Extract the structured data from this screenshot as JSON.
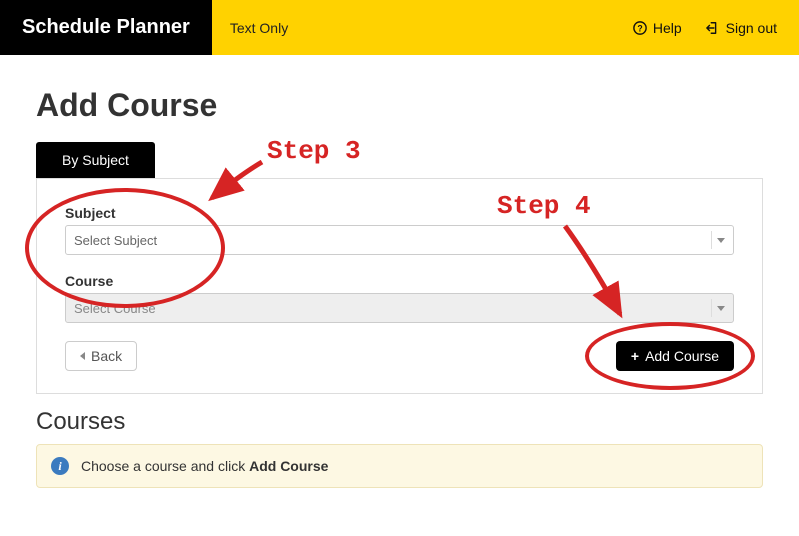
{
  "header": {
    "brand": "Schedule Planner",
    "text_only": "Text Only",
    "help": "Help",
    "signout": "Sign out"
  },
  "page": {
    "title": "Add Course",
    "tab_label": "By Subject"
  },
  "form": {
    "subject_label": "Subject",
    "subject_placeholder": "Select Subject",
    "course_label": "Course",
    "course_placeholder": "Select Course",
    "back_label": "Back",
    "add_label": "Add Course"
  },
  "courses": {
    "heading": "Courses",
    "info_prefix": "Choose a course and click ",
    "info_bold": "Add Course"
  },
  "annotations": {
    "step3": "Step 3",
    "step4": "Step 4"
  }
}
